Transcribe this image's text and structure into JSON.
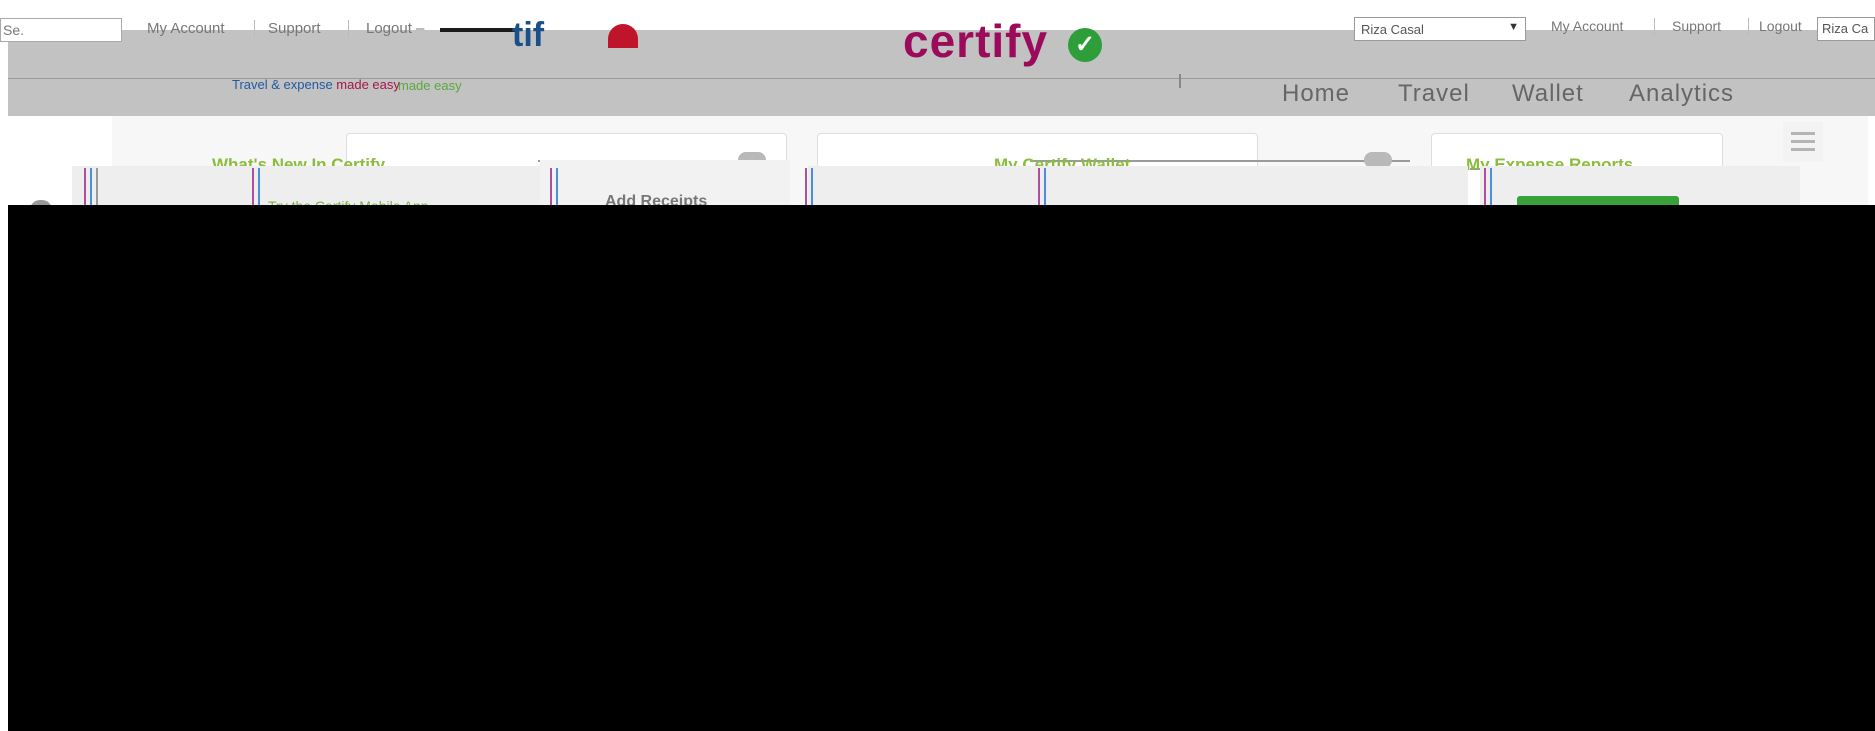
{
  "topbar": {
    "ghost_input_text": "Se.",
    "left_links": [
      "My Account",
      "Support",
      "Logout –"
    ],
    "user_select_value": "Riza Casal",
    "user_select_ghost": "Riza Ca",
    "right_links": [
      "My Account",
      "Support",
      "Logout"
    ]
  },
  "brand": {
    "logo_text": "certify",
    "ghost_logo_text": "tif",
    "tagline_prefix": "Travel & expense ",
    "tagline_emphasis": "made easy",
    "tagline_ghost": "made easy"
  },
  "nav": {
    "items": [
      "Home",
      "Travel",
      "Wallet",
      "Analytics"
    ]
  },
  "cards": {
    "whats_new": {
      "title": "What's New In Certify",
      "link": "Try the Certify Mobile App"
    },
    "receipts": {
      "action": "Add Receipts"
    },
    "wallet": {
      "title": "My Certify Wallet"
    },
    "expense_reports": {
      "title": "My Expense Reports"
    }
  },
  "colors": {
    "brand": "#9c0b5b",
    "accent_green": "#8bbd3c",
    "check_green": "#2e9e3a",
    "tagline_blue": "#1f5aa0"
  },
  "icons": [
    "check-icon",
    "menu-icon",
    "dropdown-arrow-icon"
  ]
}
